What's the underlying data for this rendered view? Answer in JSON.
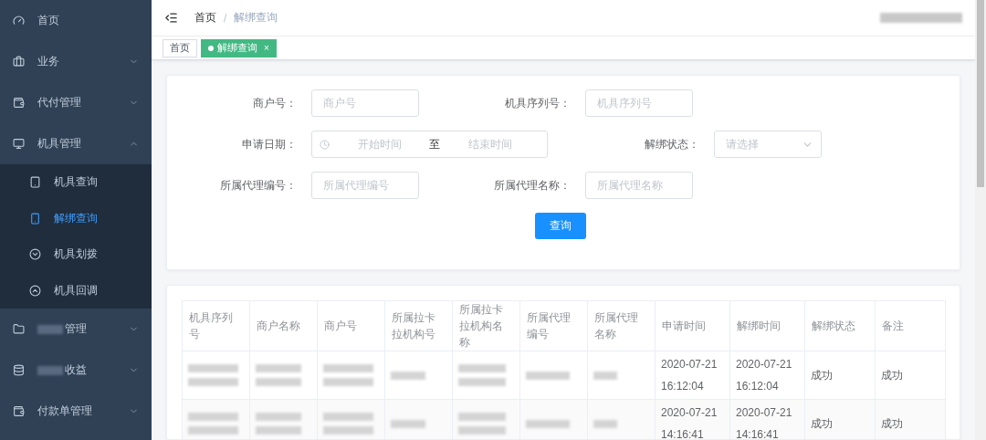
{
  "sidebar": {
    "items": [
      {
        "label": "首页",
        "kind": "link"
      },
      {
        "label": "业务",
        "kind": "group",
        "expanded": false
      },
      {
        "label": "代付管理",
        "kind": "group",
        "expanded": false
      },
      {
        "label": "机具管理",
        "kind": "group",
        "expanded": true,
        "children": [
          {
            "label": "机具查询",
            "selected": false
          },
          {
            "label": "解绑查询",
            "selected": true
          },
          {
            "label": "机具划拨",
            "selected": false
          },
          {
            "label": "机具回调",
            "selected": false
          }
        ]
      },
      {
        "label": "管理",
        "kind": "group",
        "expanded": false
      },
      {
        "label": "收益",
        "kind": "group",
        "expanded": false
      },
      {
        "label": "付款单管理",
        "kind": "group",
        "expanded": false
      }
    ]
  },
  "breadcrumb": {
    "items": [
      "首页",
      "解绑查询"
    ],
    "separator": "/"
  },
  "tags": [
    {
      "label": "首页",
      "selected": false,
      "closable": false
    },
    {
      "label": "解绑查询",
      "selected": true,
      "closable": true,
      "close": "×"
    }
  ],
  "form": {
    "rows": [
      [
        {
          "label": "商户号：",
          "kind": "input",
          "placeholder": "商户号"
        },
        {
          "label": "机具序列号：",
          "kind": "input",
          "placeholder": "机具序列号"
        }
      ],
      [
        {
          "label": "申请日期：",
          "kind": "daterange",
          "start": "开始时间",
          "sep": "至",
          "end": "结束时间"
        },
        {
          "label": "解绑状态：",
          "kind": "select",
          "placeholder": "请选择"
        }
      ],
      [
        {
          "label": "所属代理编号：",
          "kind": "input",
          "placeholder": "所属代理编号"
        },
        {
          "label": "所属代理名称：",
          "kind": "input",
          "placeholder": "所属代理名称"
        }
      ]
    ],
    "button": "查询"
  },
  "table": {
    "columns": [
      "机具序列号",
      "商户名称",
      "商户号",
      "所属拉卡拉机构号",
      "所属拉卡拉机构名称",
      "所属代理编号",
      "所属代理名称",
      "申请时间",
      "解绑时间",
      "解绑状态",
      "备注"
    ],
    "rows": [
      {
        "apply_time": "2020-07-21 16:12:04",
        "unbind_time": "2020-07-21 16:12:04",
        "status": "成功",
        "remark": "成功"
      },
      {
        "apply_time": "2020-07-21 14:16:41",
        "unbind_time": "2020-07-21 14:16:41",
        "status": "成功",
        "remark": "成功"
      }
    ]
  }
}
